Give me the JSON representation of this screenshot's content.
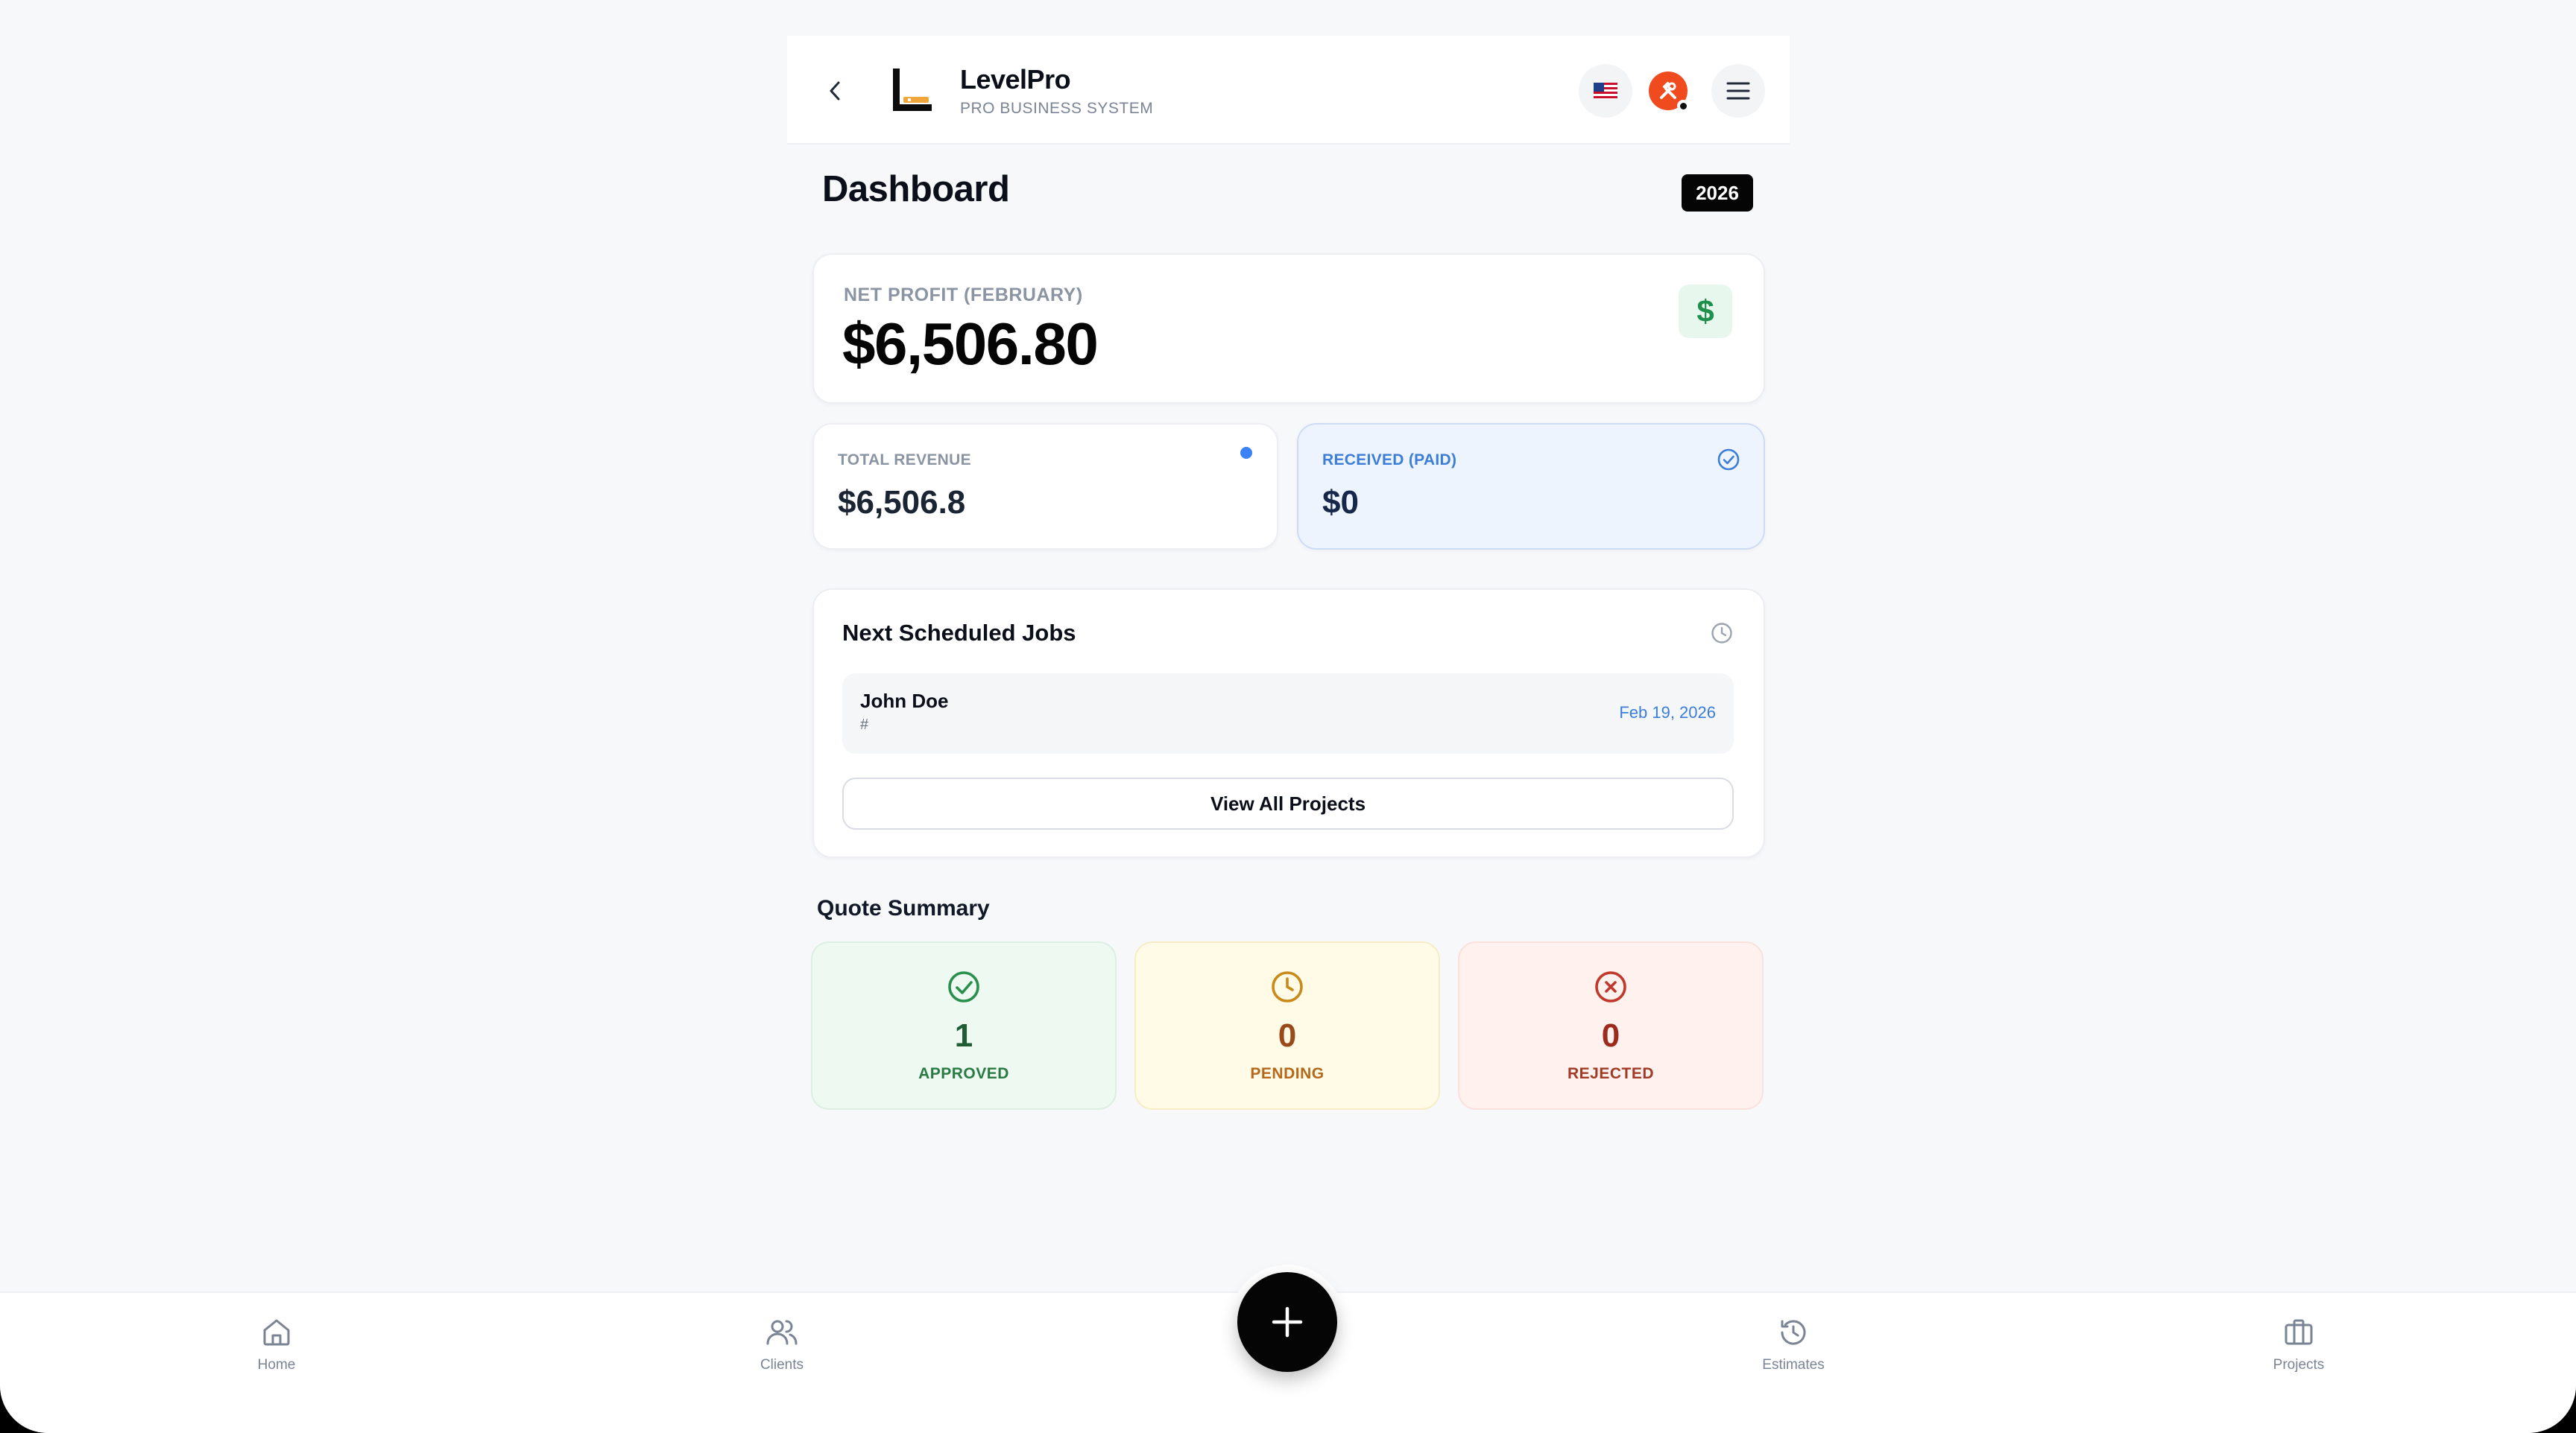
{
  "header": {
    "brand_name": "LevelPro",
    "brand_subtitle": "PRO BUSINESS SYSTEM",
    "flag_icon": "us-flag-icon",
    "tools_icon": "tools-icon",
    "menu_icon": "hamburger-menu-icon"
  },
  "page": {
    "title": "Dashboard",
    "year": "2026"
  },
  "net_profit": {
    "label": "NET PROFIT (FEBRUARY)",
    "value": "$6,506.80",
    "icon": "dollar-icon"
  },
  "total_revenue": {
    "label": "TOTAL REVENUE",
    "value": "$6,506.8"
  },
  "received": {
    "label": "RECEIVED (PAID)",
    "value": "$0"
  },
  "jobs": {
    "title": "Next Scheduled Jobs",
    "items": [
      {
        "name": "John Doe",
        "number": "#",
        "date": "Feb 19, 2026"
      }
    ],
    "view_all_label": "View All Projects"
  },
  "quotes": {
    "title": "Quote Summary",
    "approved": {
      "count": "1",
      "label": "APPROVED"
    },
    "pending": {
      "count": "0",
      "label": "PENDING"
    },
    "rejected": {
      "count": "0",
      "label": "REJECTED"
    }
  },
  "nav": {
    "home": "Home",
    "clients": "Clients",
    "estimates": "Estimates",
    "projects": "Projects"
  },
  "colors": {
    "accent_blue": "#3b82f6",
    "brand_orange": "#f04a1f",
    "success_green": "#1f8f4c",
    "pending_amber": "#c98a1b",
    "rejected_red": "#c0392b"
  }
}
